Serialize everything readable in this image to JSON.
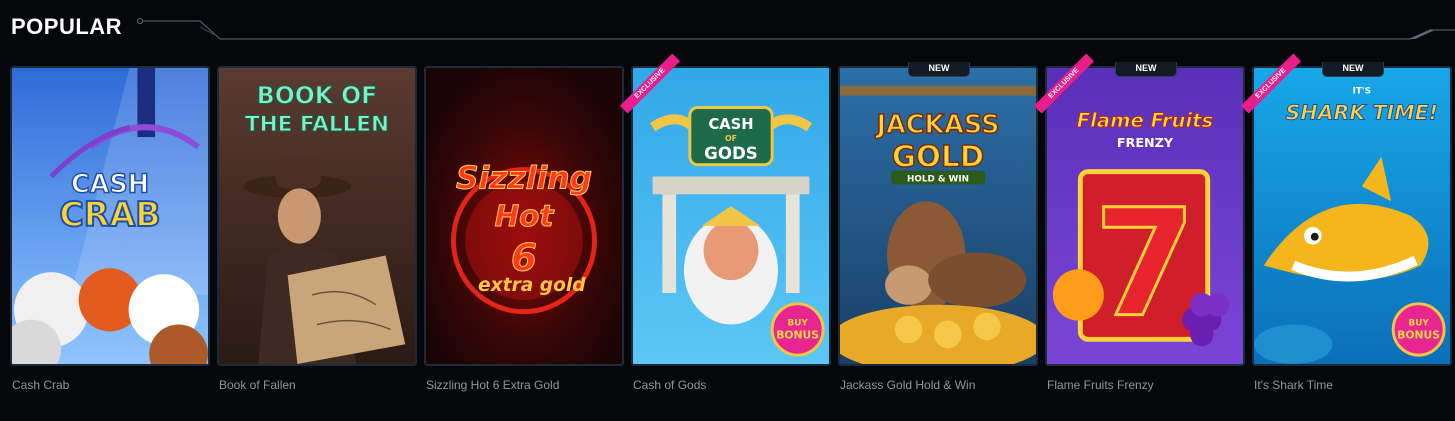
{
  "section": {
    "title": "POPULAR"
  },
  "games": [
    {
      "title": "Cash Crab",
      "art": [
        "CASH",
        "CRAB"
      ],
      "badge_new": "",
      "badge_exclusive": ""
    },
    {
      "title": "Book of Fallen",
      "art": [
        "BOOK OF",
        "THE FALLEN"
      ],
      "badge_new": "",
      "badge_exclusive": ""
    },
    {
      "title": "Sizzling Hot 6 Extra Gold",
      "art": [
        "Sizzling",
        "Hot",
        "6",
        "extra gold"
      ],
      "badge_new": "",
      "badge_exclusive": ""
    },
    {
      "title": "Cash of Gods",
      "art": [
        "CASH",
        "OF",
        "GODS"
      ],
      "badge_new": "",
      "badge_exclusive": "EXCLUSIVE",
      "bonus": [
        "BUY",
        "BONUS"
      ]
    },
    {
      "title": "Jackass Gold Hold & Win",
      "art": [
        "JACKASS",
        "GOLD",
        "HOLD & WIN"
      ],
      "badge_new": "NEW",
      "badge_exclusive": ""
    },
    {
      "title": "Flame Fruits Frenzy",
      "art": [
        "Flame Fruits",
        "FRENZY",
        "7"
      ],
      "badge_new": "NEW",
      "badge_exclusive": "EXCLUSIVE"
    },
    {
      "title": "It's Shark Time",
      "art": [
        "IT'S",
        "SHARK TIME!"
      ],
      "badge_new": "NEW",
      "badge_exclusive": "EXCLUSIVE",
      "bonus": [
        "BUY",
        "BONUS"
      ]
    }
  ],
  "colors": {
    "background": "#05070a",
    "card_border": "#1b2b3c",
    "title_text": "#8d97a3",
    "exclusive_ribbon": "#e91e8c"
  }
}
